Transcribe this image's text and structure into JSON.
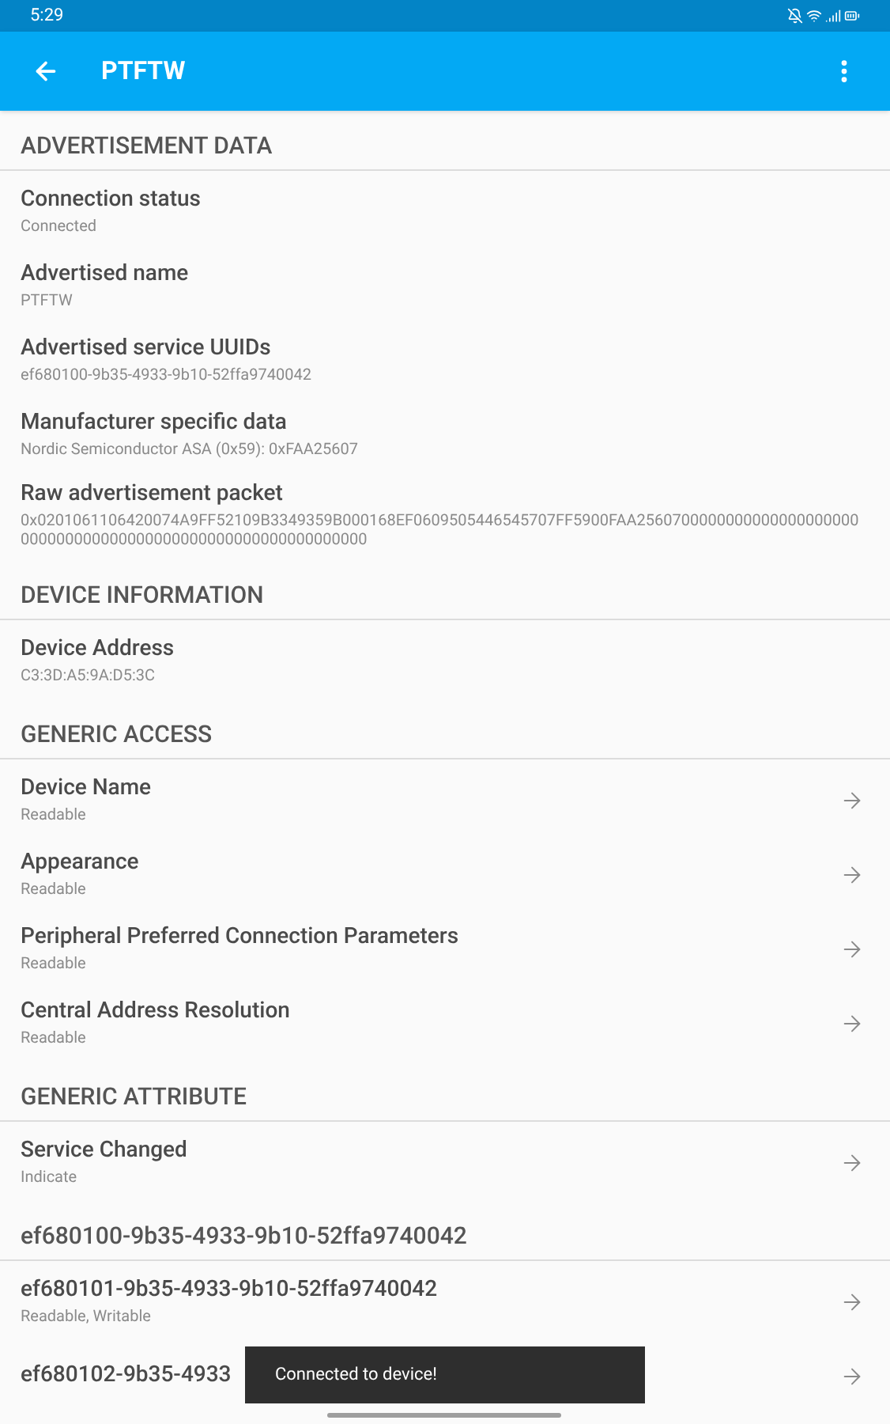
{
  "status_bar": {
    "time": "5:29"
  },
  "app_bar": {
    "title": "PTFTW"
  },
  "sections": [
    {
      "title": "ADVERTISEMENT DATA",
      "items": [
        {
          "kind": "info",
          "title": "Connection status",
          "subtitle": "Connected"
        },
        {
          "kind": "info",
          "title": "Advertised name",
          "subtitle": "PTFTW"
        },
        {
          "kind": "info",
          "title": "Advertised service UUIDs",
          "subtitle": "ef680100-9b35-4933-9b10-52ffa9740042"
        },
        {
          "kind": "info",
          "title": "Manufacturer specific data",
          "subtitle": "Nordic Semiconductor ASA (0x59): 0xFAA25607"
        },
        {
          "kind": "info",
          "title": "Raw advertisement packet",
          "subtitle": "0x0201061106420074A9FF52109B3349359B000168EF0609505446545707FF5900FAA2560700000000000000000000000000000000000000000000000000000000000"
        }
      ]
    },
    {
      "title": "DEVICE INFORMATION",
      "items": [
        {
          "kind": "info",
          "title": "Device Address",
          "subtitle": "C3:3D:A5:9A:D5:3C"
        }
      ]
    },
    {
      "title": "GENERIC ACCESS",
      "items": [
        {
          "kind": "characteristic",
          "title": "Device Name",
          "subtitle": "Readable"
        },
        {
          "kind": "characteristic",
          "title": "Appearance",
          "subtitle": "Readable"
        },
        {
          "kind": "characteristic",
          "title": "Peripheral Preferred Connection Parameters",
          "subtitle": "Readable"
        },
        {
          "kind": "characteristic",
          "title": "Central Address Resolution",
          "subtitle": "Readable"
        }
      ]
    },
    {
      "title": "GENERIC ATTRIBUTE",
      "items": [
        {
          "kind": "characteristic",
          "title": "Service Changed",
          "subtitle": "Indicate"
        }
      ]
    },
    {
      "title": "ef680100-9b35-4933-9b10-52ffa9740042",
      "items": [
        {
          "kind": "characteristic",
          "title": "ef680101-9b35-4933-9b10-52ffa9740042",
          "subtitle": "Readable, Writable"
        },
        {
          "kind": "characteristic",
          "title": "ef680102-9b35-4933"
        }
      ]
    }
  ],
  "toast": {
    "message": "Connected to device!"
  }
}
